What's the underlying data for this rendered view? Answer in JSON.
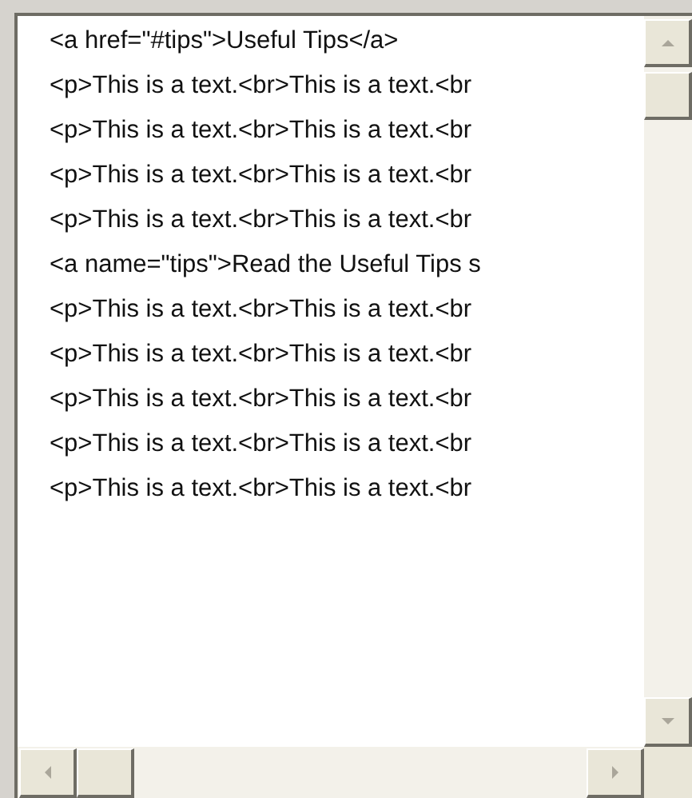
{
  "text_area": {
    "lines": [
      "<a href=\"#tips\">Useful Tips</a>",
      "<p>This is a text.<br>This is a text.<br",
      "<p>This is a text.<br>This is a text.<br",
      "<p>This is a text.<br>This is a text.<br",
      "<p>This is a text.<br>This is a text.<br",
      "<a name=\"tips\">Read the Useful Tips s",
      "<p>This is a text.<br>This is a text.<br",
      "<p>This is a text.<br>This is a text.<br",
      "<p>This is a text.<br>This is a text.<br",
      "<p>This is a text.<br>This is a text.<br",
      "<p>This is a text.<br>This is a text.<br"
    ]
  }
}
